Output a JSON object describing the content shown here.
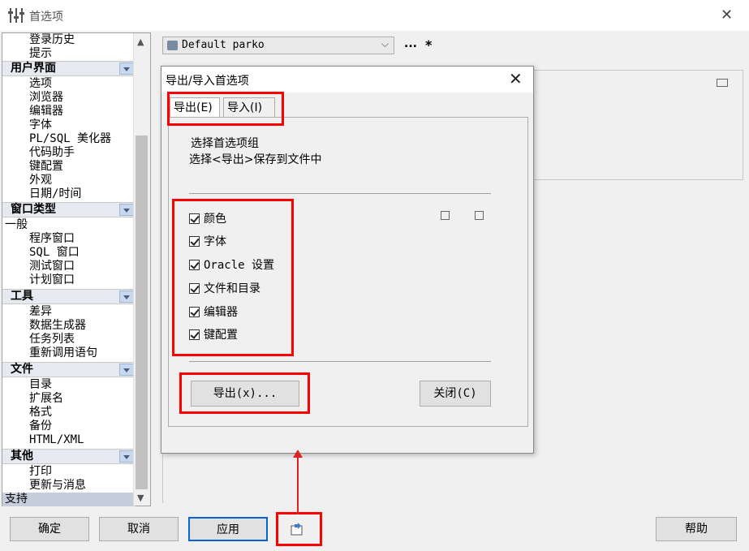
{
  "window": {
    "title": "首选项",
    "close_glyph": "✕"
  },
  "tree": {
    "top_items": [
      "登录历史",
      "提示"
    ],
    "sections": [
      {
        "header": "用户界面",
        "items": [
          "选项",
          "浏览器",
          "编辑器",
          "字体",
          "PL/SQL 美化器",
          "代码助手",
          "键配置",
          "外观",
          "日期/时间"
        ]
      },
      {
        "header": "窗口类型",
        "items": [
          "一般",
          "程序窗口",
          "SQL 窗口",
          "测试窗口",
          "计划窗口"
        ]
      },
      {
        "header": "工具",
        "items": [
          "差异",
          "数据生成器",
          "任务列表",
          "重新调用语句"
        ]
      },
      {
        "header": "文件",
        "items": [
          "目录",
          "扩展名",
          "格式",
          "备份",
          "HTML/XML"
        ]
      },
      {
        "header": "其他",
        "items": [
          "打印",
          "更新与消息",
          "支持"
        ]
      }
    ],
    "selected": "支持"
  },
  "profile": {
    "value": "Default parko",
    "dots_label": "...",
    "star_label": "*"
  },
  "dialog": {
    "title": "导出/导入首选项",
    "close_glyph": "✕",
    "tabs": {
      "export": "导出(E)",
      "import": "导入(I)"
    },
    "desc1": "选择首选项组",
    "desc2": "选择<导出>保存到文件中",
    "checkboxes": [
      "颜色",
      "字体",
      "Oracle 设置",
      "文件和目录",
      "编辑器",
      "键配置"
    ],
    "export_button": "导出(x)...",
    "close_button": "关闭(C)"
  },
  "bottom": {
    "ok": "确定",
    "cancel": "取消",
    "apply": "应用",
    "help": "帮助"
  },
  "colors": {
    "annotation": "#ff0000",
    "accent": "#0a64d0"
  }
}
